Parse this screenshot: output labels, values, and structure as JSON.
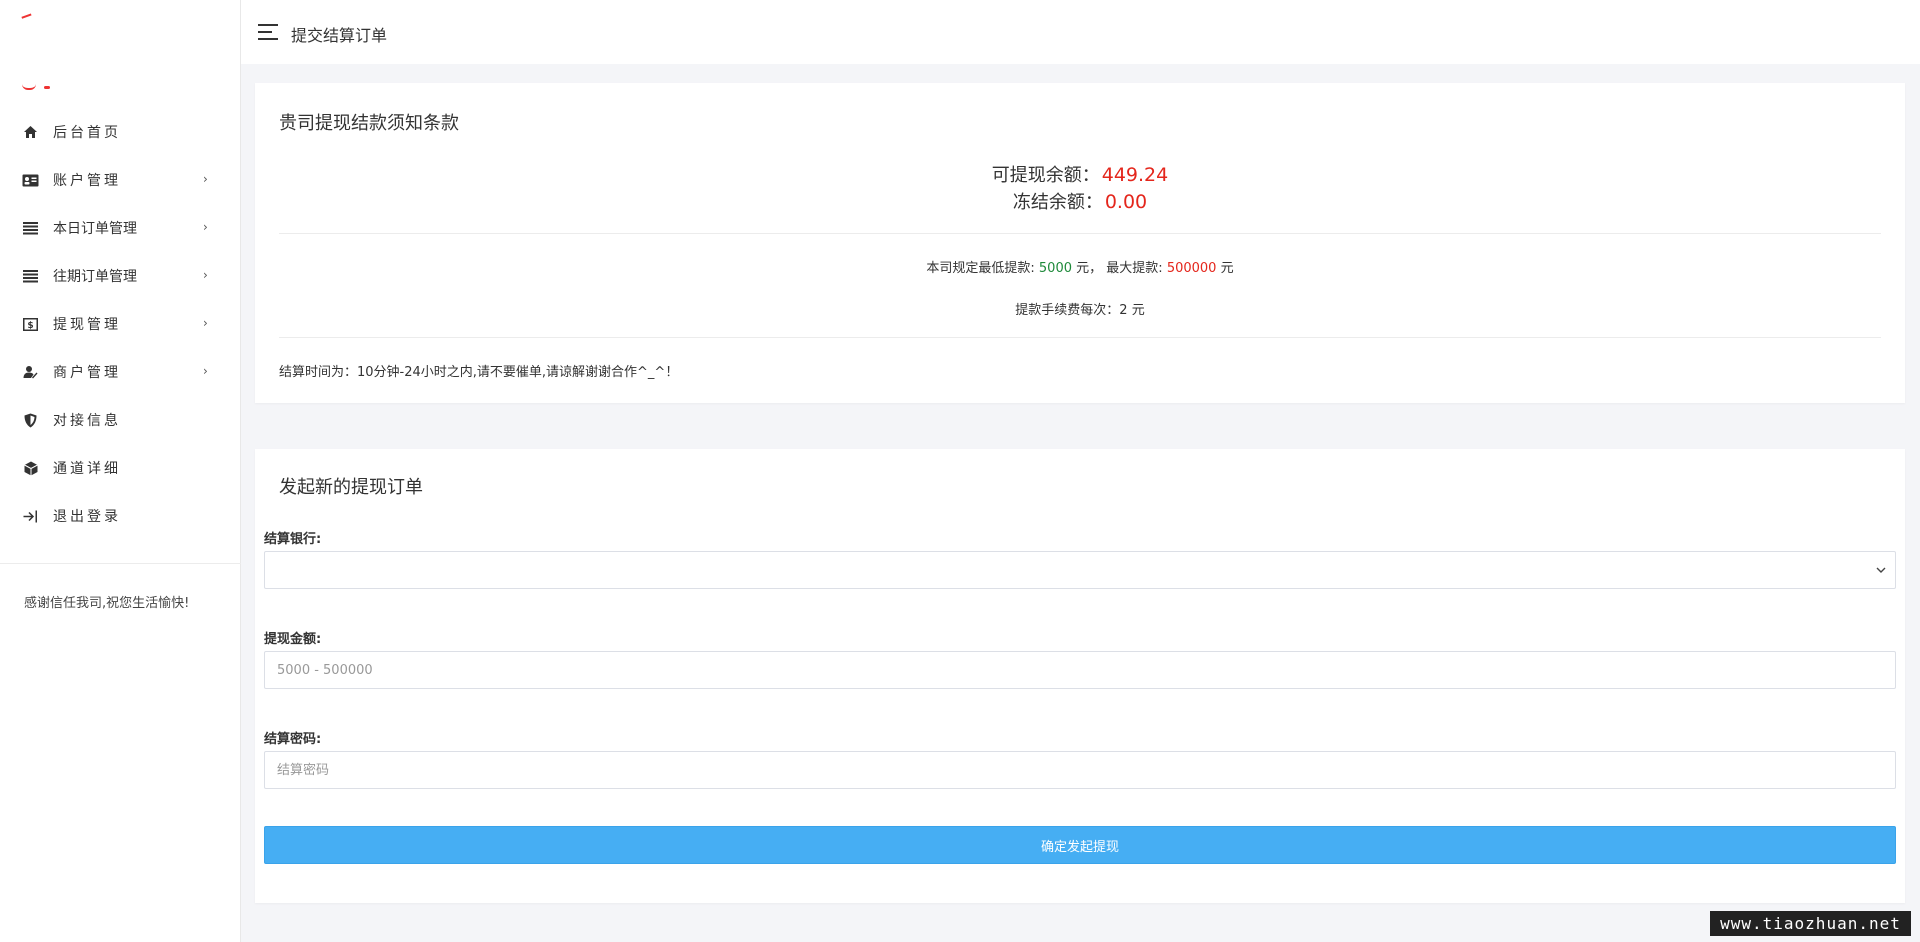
{
  "header": {
    "title": "提交结算订单"
  },
  "sidebar": {
    "items": [
      {
        "label": "后台首页",
        "icon": "home-icon",
        "has_arrow": false
      },
      {
        "label": "账户管理",
        "icon": "id-card-icon",
        "has_arrow": true
      },
      {
        "label": "本日订单管理",
        "icon": "list-icon",
        "has_arrow": true
      },
      {
        "label": "往期订单管理",
        "icon": "list-icon",
        "has_arrow": true
      },
      {
        "label": "提现管理",
        "icon": "dollar-icon",
        "has_arrow": true
      },
      {
        "label": "商户管理",
        "icon": "user-icon",
        "has_arrow": true
      },
      {
        "label": "对接信息",
        "icon": "shield-icon",
        "has_arrow": false
      },
      {
        "label": "通道详细",
        "icon": "cube-icon",
        "has_arrow": false
      },
      {
        "label": "退出登录",
        "icon": "logout-icon",
        "has_arrow": false
      }
    ],
    "arrow": "›",
    "footer": "感谢信任我司,祝您生活愉快!"
  },
  "terms": {
    "title": "贵司提现结款须知条款",
    "withdrawable_label": "可提现余额：",
    "withdrawable_value": "449.24",
    "frozen_label": "冻结余额：",
    "frozen_value": "0.00",
    "min_label": "本司规定最低提款:",
    "min_value": "5000",
    "unit1": "元，",
    "max_label": "最大提款:",
    "max_value": "500000",
    "unit2": "元",
    "fee": "提款手续费每次：2 元",
    "settle_time": "结算时间为：10分钟-24小时之内,请不要催单,请谅解谢谢合作^_^！"
  },
  "form": {
    "title": "发起新的提现订单",
    "bank_label": "结算银行:",
    "bank_value": "",
    "amount_label": "提现金额:",
    "amount_placeholder": "5000 - 500000",
    "password_label": "结算密码:",
    "password_placeholder": "结算密码",
    "submit_label": "确定发起提现"
  },
  "watermark": "www.tiaozhuan.net",
  "colors": {
    "accent_button": "#46aef3",
    "amount_red": "#e4261c",
    "min_green": "#1f8a3b"
  }
}
